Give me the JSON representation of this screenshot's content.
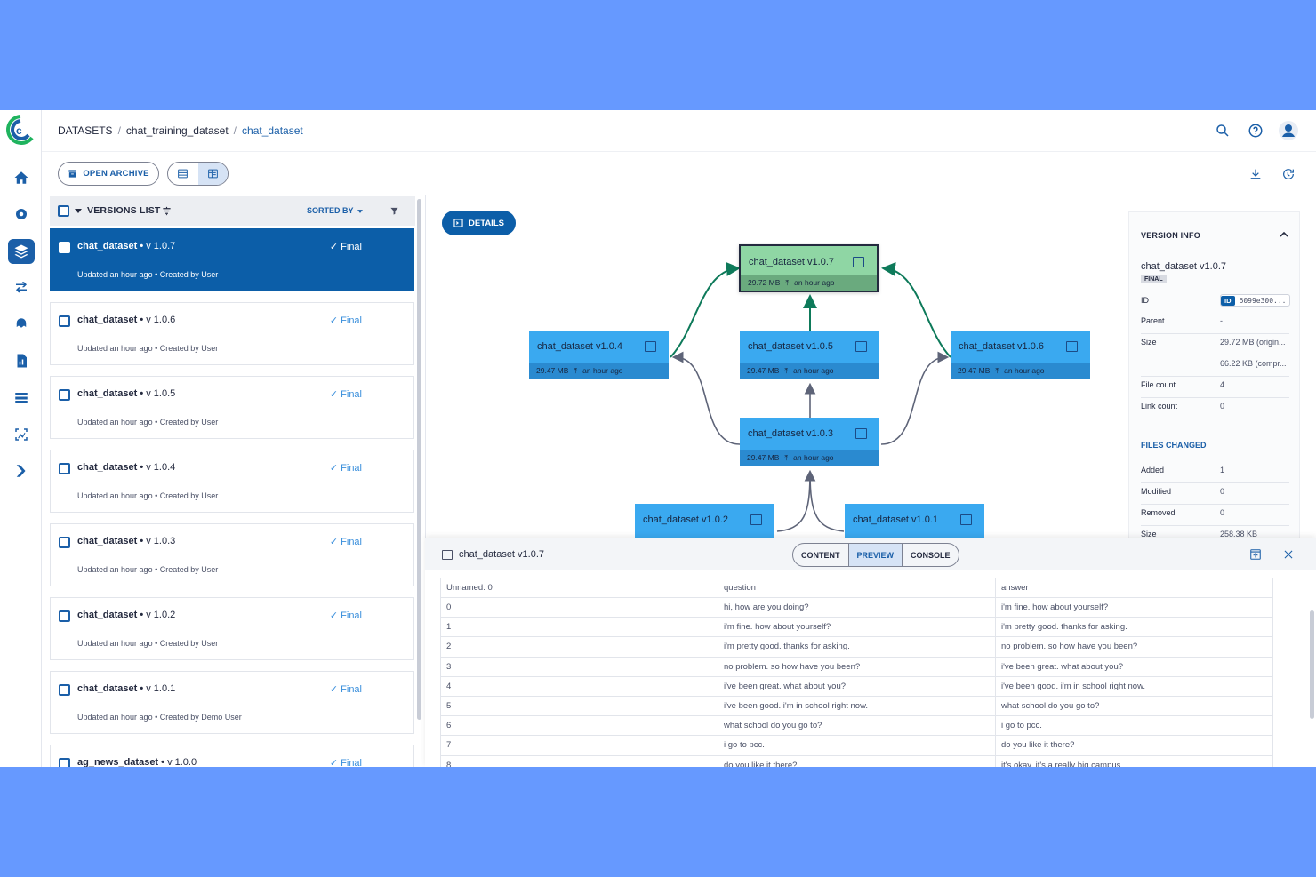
{
  "header": {
    "breadcrumbs": [
      "DATASETS",
      "chat_training_dataset",
      "chat_dataset"
    ]
  },
  "toolbar": {
    "open_archive_label": "OPEN ARCHIVE"
  },
  "versions_list": {
    "title": "VERSIONS LIST",
    "sorted_by_label": "SORTED BY",
    "items": [
      {
        "name": "chat_dataset",
        "version": "v 1.0.7",
        "status": "Final",
        "updated": "Updated an hour ago",
        "created": "Created by User",
        "selected": true
      },
      {
        "name": "chat_dataset",
        "version": "v 1.0.6",
        "status": "Final",
        "updated": "Updated an hour ago",
        "created": "Created by User"
      },
      {
        "name": "chat_dataset",
        "version": "v 1.0.5",
        "status": "Final",
        "updated": "Updated an hour ago",
        "created": "Created by User"
      },
      {
        "name": "chat_dataset",
        "version": "v 1.0.4",
        "status": "Final",
        "updated": "Updated an hour ago",
        "created": "Created by User"
      },
      {
        "name": "chat_dataset",
        "version": "v 1.0.3",
        "status": "Final",
        "updated": "Updated an hour ago",
        "created": "Created by User"
      },
      {
        "name": "chat_dataset",
        "version": "v 1.0.2",
        "status": "Final",
        "updated": "Updated an hour ago",
        "created": "Created by User"
      },
      {
        "name": "chat_dataset",
        "version": "v 1.0.1",
        "status": "Final",
        "updated": "Updated an hour ago",
        "created": "Created by Demo User"
      },
      {
        "name": "ag_news_dataset",
        "version": "v 1.0.0",
        "status": "Final",
        "updated": "",
        "created": ""
      }
    ]
  },
  "graph": {
    "details_label": "DETAILS",
    "nodes": [
      {
        "id": "n107",
        "label": "chat_dataset v1.0.7",
        "size": "29.72 MB",
        "time": "an hour ago",
        "current": true
      },
      {
        "id": "n104",
        "label": "chat_dataset v1.0.4",
        "size": "29.47 MB",
        "time": "an hour ago"
      },
      {
        "id": "n105",
        "label": "chat_dataset v1.0.5",
        "size": "29.47 MB",
        "time": "an hour ago"
      },
      {
        "id": "n106",
        "label": "chat_dataset v1.0.6",
        "size": "29.47 MB",
        "time": "an hour ago"
      },
      {
        "id": "n103",
        "label": "chat_dataset v1.0.3",
        "size": "29.47 MB",
        "time": "an hour ago"
      },
      {
        "id": "n102",
        "label": "chat_dataset v1.0.2"
      },
      {
        "id": "n101",
        "label": "chat_dataset v1.0.1"
      }
    ]
  },
  "version_info": {
    "title": "VERSION INFO",
    "name": "chat_dataset v1.0.7",
    "badge": "FINAL",
    "id_tag": "ID",
    "id_value": "6099e300...",
    "rows": [
      {
        "k": "Parent",
        "v": "-"
      },
      {
        "k": "Size",
        "v": "29.72 MB (origin..."
      },
      {
        "k": "",
        "v": "66.22 KB (compr..."
      },
      {
        "k": "File count",
        "v": "4"
      },
      {
        "k": "Link count",
        "v": "0"
      }
    ],
    "files_changed_title": "FILES CHANGED",
    "files_changed": [
      {
        "k": "Added",
        "v": "1"
      },
      {
        "k": "Modified",
        "v": "0"
      },
      {
        "k": "Removed",
        "v": "0"
      },
      {
        "k": "Size",
        "v": "258.38 KB"
      }
    ]
  },
  "preview": {
    "title": "chat_dataset v1.0.7",
    "tabs": [
      "CONTENT",
      "PREVIEW",
      "CONSOLE"
    ],
    "active_tab": "PREVIEW",
    "columns": [
      "Unnamed: 0",
      "question",
      "answer"
    ],
    "rows": [
      [
        "0",
        "hi, how are you doing?",
        "i'm fine. how about yourself?"
      ],
      [
        "1",
        "i'm fine. how about yourself?",
        "i'm pretty good. thanks for asking."
      ],
      [
        "2",
        "i'm pretty good. thanks for asking.",
        "no problem. so how have you been?"
      ],
      [
        "3",
        "no problem. so how have you been?",
        "i've been great. what about you?"
      ],
      [
        "4",
        "i've been great. what about you?",
        "i've been good. i'm in school right now."
      ],
      [
        "5",
        "i've been good. i'm in school right now.",
        "what school do you go to?"
      ],
      [
        "6",
        "what school do you go to?",
        "i go to pcc."
      ],
      [
        "7",
        "i go to pcc.",
        "do you like it there?"
      ],
      [
        "8",
        "do you like it there?",
        "it's okay. it's a really big campus."
      ]
    ]
  }
}
